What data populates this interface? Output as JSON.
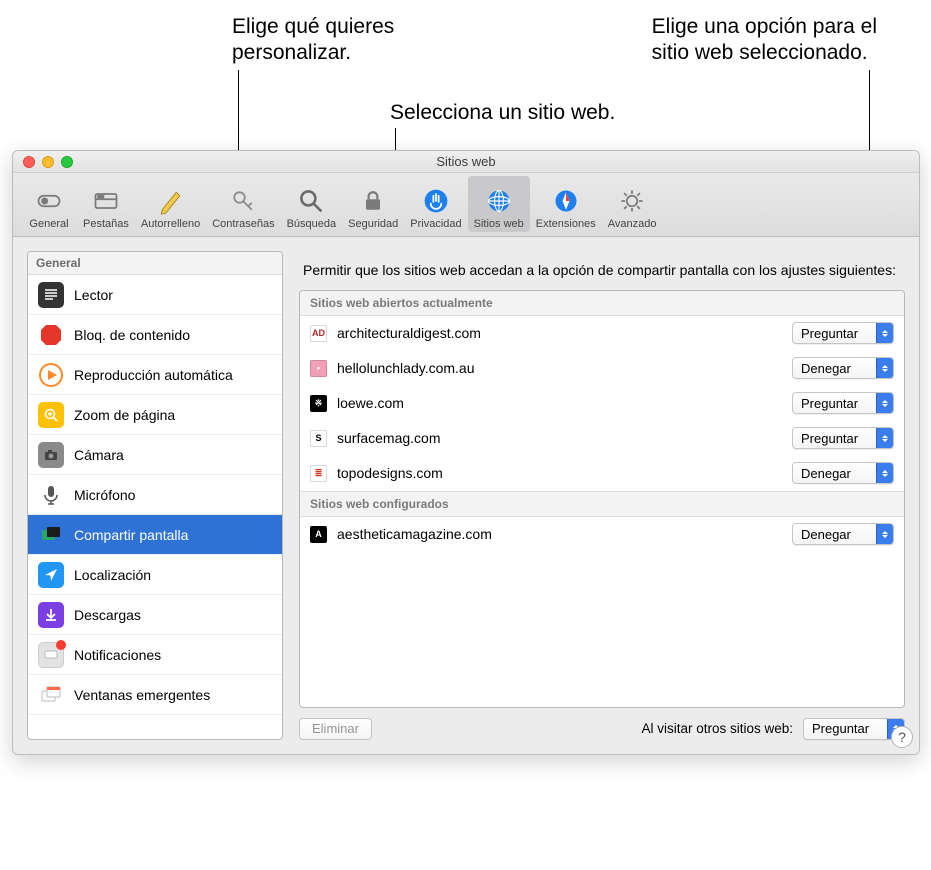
{
  "callouts": {
    "left_l1": "Elige qué quieres",
    "left_l2": "personalizar.",
    "right_l1": "Elige una opción para el",
    "right_l2": "sitio web seleccionado.",
    "center": "Selecciona un sitio web."
  },
  "window": {
    "title": "Sitios web"
  },
  "toolbar": {
    "items": [
      {
        "label": "General",
        "icon": "general"
      },
      {
        "label": "Pestañas",
        "icon": "tabs"
      },
      {
        "label": "Autorrelleno",
        "icon": "autofill"
      },
      {
        "label": "Contraseñas",
        "icon": "passwords"
      },
      {
        "label": "Búsqueda",
        "icon": "search"
      },
      {
        "label": "Seguridad",
        "icon": "security"
      },
      {
        "label": "Privacidad",
        "icon": "privacy"
      },
      {
        "label": "Sitios web",
        "icon": "websites"
      },
      {
        "label": "Extensiones",
        "icon": "extensions"
      },
      {
        "label": "Avanzado",
        "icon": "advanced"
      }
    ]
  },
  "sidebar": {
    "header": "General",
    "items": [
      {
        "label": "Lector"
      },
      {
        "label": "Bloq. de contenido"
      },
      {
        "label": "Reproducción automática"
      },
      {
        "label": "Zoom de página"
      },
      {
        "label": "Cámara"
      },
      {
        "label": "Micrófono"
      },
      {
        "label": "Compartir pantalla"
      },
      {
        "label": "Localización"
      },
      {
        "label": "Descargas"
      },
      {
        "label": "Notificaciones"
      },
      {
        "label": "Ventanas emergentes"
      }
    ]
  },
  "main": {
    "description": "Permitir que los sitios web accedan a la opción de compartir pantalla con los ajustes siguientes:",
    "open_header": "Sitios web abiertos actualmente",
    "configured_header": "Sitios web configurados",
    "open_sites": [
      {
        "domain": "architecturaldigest.com",
        "value": "Preguntar",
        "fav_text": "AD",
        "fav_bg": "#ffffff",
        "fav_fg": "#c02828"
      },
      {
        "domain": "hellolunchlady.com.au",
        "value": "Denegar",
        "fav_text": "•",
        "fav_bg": "#f2a0b7",
        "fav_fg": "#ffffff"
      },
      {
        "domain": "loewe.com",
        "value": "Preguntar",
        "fav_text": "※",
        "fav_bg": "#000000",
        "fav_fg": "#ffffff"
      },
      {
        "domain": "surfacemag.com",
        "value": "Preguntar",
        "fav_text": "S",
        "fav_bg": "#ffffff",
        "fav_fg": "#000000"
      },
      {
        "domain": "topodesigns.com",
        "value": "Denegar",
        "fav_text": "≣",
        "fav_bg": "#ffffff",
        "fav_fg": "#d63b1f"
      }
    ],
    "configured_sites": [
      {
        "domain": "aestheticamagazine.com",
        "value": "Denegar",
        "fav_text": "A",
        "fav_bg": "#000000",
        "fav_fg": "#ffffff"
      }
    ],
    "delete_label": "Eliminar",
    "default_label": "Al visitar otros sitios web:",
    "default_value": "Preguntar"
  },
  "help": "?"
}
